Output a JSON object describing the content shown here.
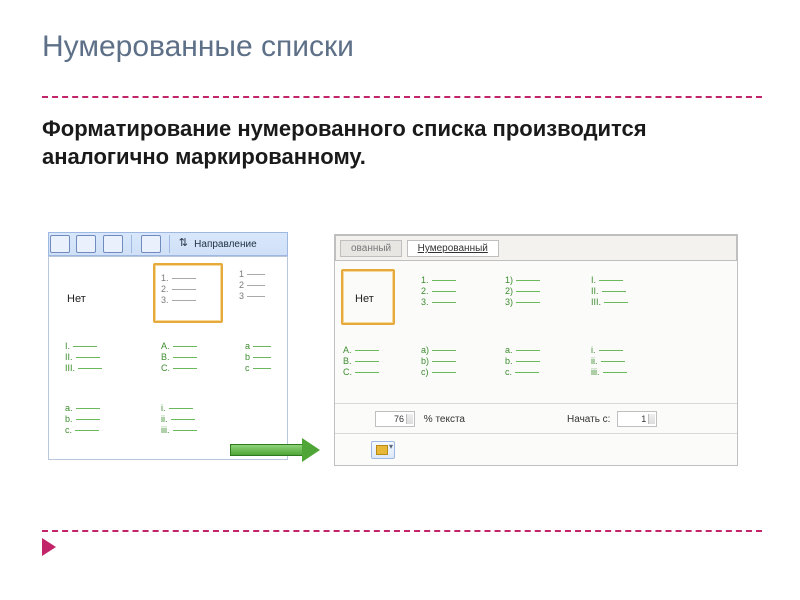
{
  "title": "Нумерованные списки",
  "body": "Форматирование нумерованного списка производится аналогично маркированному.",
  "left": {
    "ribbon_label": "Направление",
    "none": "Нет",
    "grid": {
      "r1c2": [
        "1.",
        "2.",
        "3."
      ],
      "r1c3": [
        "1",
        "2",
        "3"
      ],
      "r2c1": [
        "I.",
        "II.",
        "III."
      ],
      "r2c2": [
        "A.",
        "B.",
        "C."
      ],
      "r2c3": [
        "a",
        "b",
        "c"
      ],
      "r3c1": [
        "a.",
        "b.",
        "c."
      ],
      "r3c2": [
        "i.",
        "ii.",
        "iii."
      ]
    }
  },
  "right": {
    "tab_inactive_suffix": "ованный",
    "tab_active": "Нумерованный",
    "none": "Нет",
    "grid": {
      "r1c2": [
        "1.",
        "2.",
        "3."
      ],
      "r1c3": [
        "1)",
        "2)",
        "3)"
      ],
      "r1c4": [
        "I.",
        "II.",
        "III."
      ],
      "r2c1": [
        "A.",
        "B.",
        "C."
      ],
      "r2c2": [
        "a)",
        "b)",
        "c)"
      ],
      "r2c3": [
        "a.",
        "b.",
        "c."
      ],
      "r2c4": [
        "i.",
        "ii.",
        "iii."
      ]
    },
    "footer": {
      "percent_value": "76",
      "percent_label": "% текста",
      "start_label": "Начать с:",
      "start_value": "1"
    }
  }
}
